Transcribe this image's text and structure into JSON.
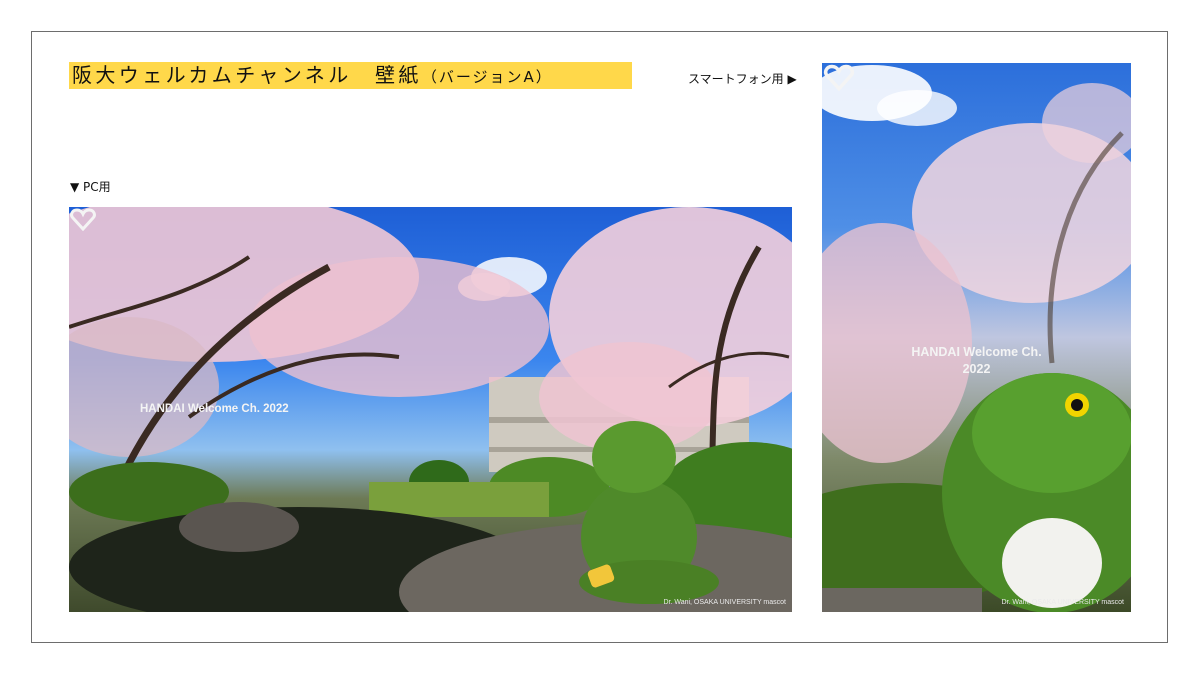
{
  "page": {
    "title_main": "阪大ウェルカムチャンネル　壁紙",
    "title_sub": "（バージョンA）",
    "smartphone_label": "スマートフォン用 ▶",
    "pc_label": "▼ PC用"
  },
  "pc_wallpaper": {
    "brand_text": "HANDAI Welcome Ch. 2022",
    "credit_text": "Dr. Wani, OSAKA UNIVERSITY mascot",
    "logo_icon": "handai-logo-icon",
    "alt": "Cherry blossoms and a green crocodile mascot plush sitting on a rock by a pond"
  },
  "sp_wallpaper": {
    "brand_line1": "HANDAI Welcome Ch.",
    "brand_line2": "2022",
    "credit_text": "Dr. Wani, OSAKA UNIVERSITY mascot",
    "logo_icon": "handai-logo-icon",
    "alt": "Close-up of the green crocodile mascot plush under cherry blossoms"
  },
  "colors": {
    "title_highlight": "#ffd84a",
    "frame_border": "#6d6d6d",
    "sky": "#2d72e0",
    "blossom": "#f3c9d6",
    "mascot_green": "#4f8a2a"
  }
}
